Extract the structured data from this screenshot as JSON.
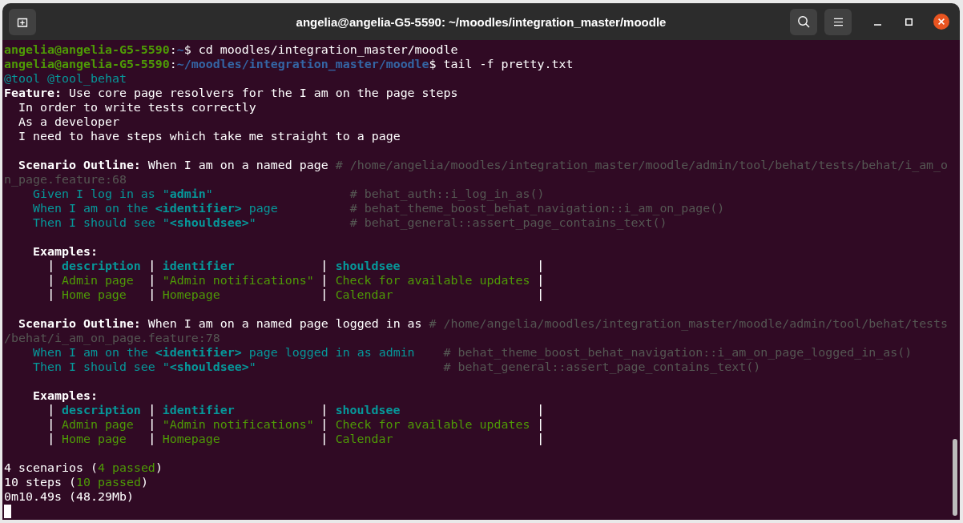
{
  "window": {
    "title": "angelia@angelia-G5-5590: ~/moodles/integration_master/moodle"
  },
  "terminal": {
    "commands": [
      {
        "segments": [
          {
            "text": "angelia@angelia-G5-5590",
            "kind": "user"
          },
          {
            "text": ":",
            "kind": "plain"
          },
          {
            "text": "~",
            "kind": "path"
          },
          {
            "text": "$ cd moodles/integration_master/moodle",
            "kind": "plain"
          }
        ]
      },
      {
        "segments": [
          {
            "text": "angelia@angelia-G5-5590",
            "kind": "user"
          },
          {
            "text": ":",
            "kind": "plain"
          },
          {
            "text": "~/moodles/integration_master/moodle",
            "kind": "path"
          },
          {
            "text": "$ tail -f pretty.txt",
            "kind": "plain"
          }
        ]
      }
    ],
    "tags": "@tool @tool_behat",
    "feature": {
      "title": "**Feature:** Use core page resolvers for the I am on the page steps",
      "description": [
        "In order to write tests correctly",
        "As a developer",
        "I need to have steps which take me straight to a page"
      ]
    },
    "scenarios": [
      {
        "title": "**Scenario Outline:** When I am on a named page",
        "location": "# /home/angelia/moodles/integration_master/moodle/admin/tool/behat/tests/behat/i_am_o",
        "location_wrapped": "n_page.feature:68",
        "steps": [
          {
            "text": "Given I log in as \"**admin**\"",
            "definition": "# behat_auth::i_log_in_as()"
          },
          {
            "text": "When I am on the **<identifier>** page",
            "definition": "# behat_theme_boost_behat_navigation::i_am_on_page()"
          },
          {
            "text": "Then I should see \"**<shouldsee>**\"",
            "definition": "# behat_general::assert_page_contains_text()"
          }
        ],
        "examples": {
          "label": "Examples:",
          "columns": [
            "description",
            "identifier",
            "shouldsee"
          ],
          "rows": [
            [
              "Admin page",
              "\"Admin notifications\"",
              "Check for available updates"
            ],
            [
              "Home page",
              "Homepage",
              "Calendar"
            ]
          ]
        }
      },
      {
        "title": "**Scenario Outline:** When I am on a named page logged in as",
        "location": "# /home/angelia/moodles/integration_master/moodle/admin/tool/behat/tests",
        "location_wrapped": "/behat/i_am_on_page.feature:78",
        "steps": [
          {
            "text": "When I am on the **<identifier>** page logged in as admin",
            "definition": "# behat_theme_boost_behat_navigation::i_am_on_page_logged_in_as()"
          },
          {
            "text": "Then I should see \"**<shouldsee>**\"",
            "definition": "# behat_general::assert_page_contains_text()"
          }
        ],
        "examples": {
          "label": "Examples:",
          "columns": [
            "description",
            "identifier",
            "shouldsee"
          ],
          "rows": [
            [
              "Admin page",
              "\"Admin notifications\"",
              "Check for available updates"
            ],
            [
              "Home page",
              "Homepage",
              "Calendar"
            ]
          ]
        }
      }
    ],
    "summary": [
      {
        "segments": [
          {
            "text": "4 scenarios (",
            "kind": "plain"
          },
          {
            "text": "4 passed",
            "kind": "passed"
          },
          {
            "text": ")",
            "kind": "plain"
          }
        ]
      },
      {
        "segments": [
          {
            "text": "10 steps (",
            "kind": "plain"
          },
          {
            "text": "10 passed",
            "kind": "passed"
          },
          {
            "text": ")",
            "kind": "plain"
          }
        ]
      },
      {
        "segments": [
          {
            "text": "0m10.49s (48.29Mb)",
            "kind": "plain"
          }
        ]
      }
    ]
  }
}
